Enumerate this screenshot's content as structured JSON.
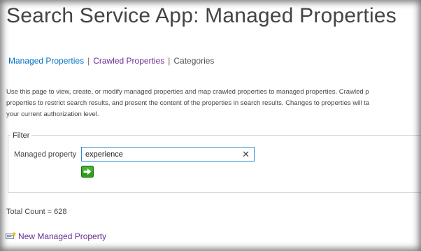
{
  "page": {
    "title": "Search Service App: Managed Properties"
  },
  "nav": {
    "managed_properties": "Managed Properties",
    "crawled_properties": "Crawled Properties",
    "categories": "Categories",
    "separator": "|"
  },
  "intro_text": "Use this page to view, create, or modify managed properties and map crawled properties to managed properties. Crawled p\nproperties to restrict search results, and present the content of the properties in search results. Changes to properties will ta\nyour current authorization level.",
  "filter": {
    "legend": "Filter",
    "managed_property_label": "Managed property",
    "managed_property_value": "experience",
    "clear_glyph": "✕",
    "go_icon": "go-arrow-icon"
  },
  "total_count": "Total Count = 628",
  "new_managed_property": {
    "label": "New Managed Property",
    "icon": "new-property-icon"
  },
  "colors": {
    "active_link": "#0072c6",
    "visited_link": "#6a2c91",
    "input_border": "#2a8dd4",
    "go_button": "#2f9e1e"
  }
}
